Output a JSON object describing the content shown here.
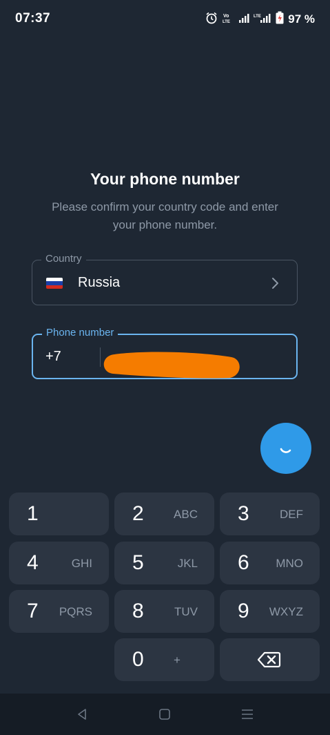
{
  "status_bar": {
    "time": "07:37",
    "battery": "97 %",
    "icons": [
      "alarm-icon",
      "volte-icon",
      "signal-icon",
      "lte-signal-icon",
      "battery-icon"
    ]
  },
  "page": {
    "title": "Your phone number",
    "subtitle": "Please confirm your country code and enter your phone number."
  },
  "country_field": {
    "label": "Country",
    "value": "Russia",
    "flag": "russia-flag-icon"
  },
  "phone_field": {
    "label": "Phone number",
    "code": "+7",
    "number": ""
  },
  "keypad": {
    "keys": [
      {
        "num": "1",
        "letters": ""
      },
      {
        "num": "2",
        "letters": "ABC"
      },
      {
        "num": "3",
        "letters": "DEF"
      },
      {
        "num": "4",
        "letters": "GHI"
      },
      {
        "num": "5",
        "letters": "JKL"
      },
      {
        "num": "6",
        "letters": "MNO"
      },
      {
        "num": "7",
        "letters": "PQRS"
      },
      {
        "num": "8",
        "letters": "TUV"
      },
      {
        "num": "9",
        "letters": "WXYZ"
      },
      {
        "num": "0",
        "letters": "+"
      }
    ]
  },
  "colors": {
    "background": "#1e2733",
    "accent": "#2f9ae8",
    "focus_border": "#6bb5f0",
    "redaction": "#f57c00",
    "key_background": "#2c3542"
  }
}
